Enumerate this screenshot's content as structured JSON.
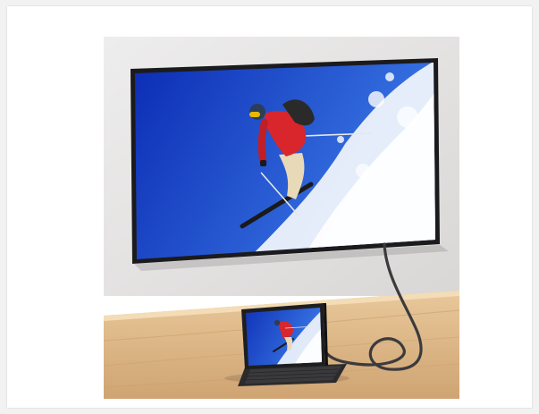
{
  "photo": {
    "colors": {
      "page_background": "#f2f2f2",
      "frame": "#ffffff",
      "wall_light": "#eeeded",
      "wall_shadow": "#d9d7d6",
      "desk_wood": "#e9c89b",
      "desk_grain": "#cfa472",
      "tv_bezel": "#1b1b1d",
      "sky_deep": "#0b2bb3",
      "sky_light": "#3c7be8",
      "snow": "#f4f7fc",
      "jacket_red": "#d8262c",
      "cable": "#3b3b3e"
    }
  }
}
